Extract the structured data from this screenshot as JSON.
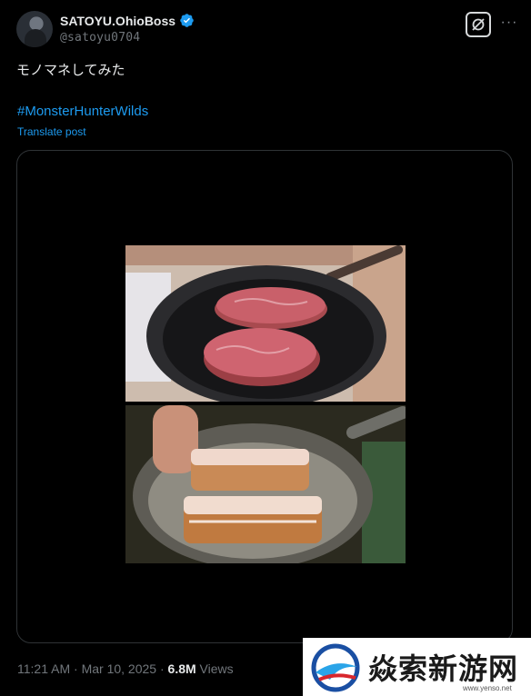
{
  "post": {
    "author": {
      "display_name": "SATOYU.OhioBoss",
      "handle": "@satoyu0704",
      "verified": true,
      "avatar_icon": "user-avatar"
    },
    "text": "モノマネしてみた",
    "hashtag": "#MonsterHunterWilds",
    "translate_label": "Translate post",
    "media": {
      "type": "video",
      "description_icons": [
        "frying-pan-steak",
        "frying-pan-bacon"
      ]
    },
    "footer": {
      "time": "11:21 AM",
      "separator": "·",
      "date": "Mar 10, 2025",
      "views_count": "6.8M",
      "views_label": "Views"
    }
  },
  "actions": {
    "grok_icon": "grok-icon",
    "more_icon": "more-icon",
    "more_label": "···"
  },
  "watermark": {
    "text": "焱索新游网",
    "url": "www.yenso.net"
  },
  "colors": {
    "background": "#000000",
    "text_primary": "#e7e9ea",
    "text_secondary": "#71767b",
    "link": "#1d9bf0",
    "border": "#2f3336"
  }
}
